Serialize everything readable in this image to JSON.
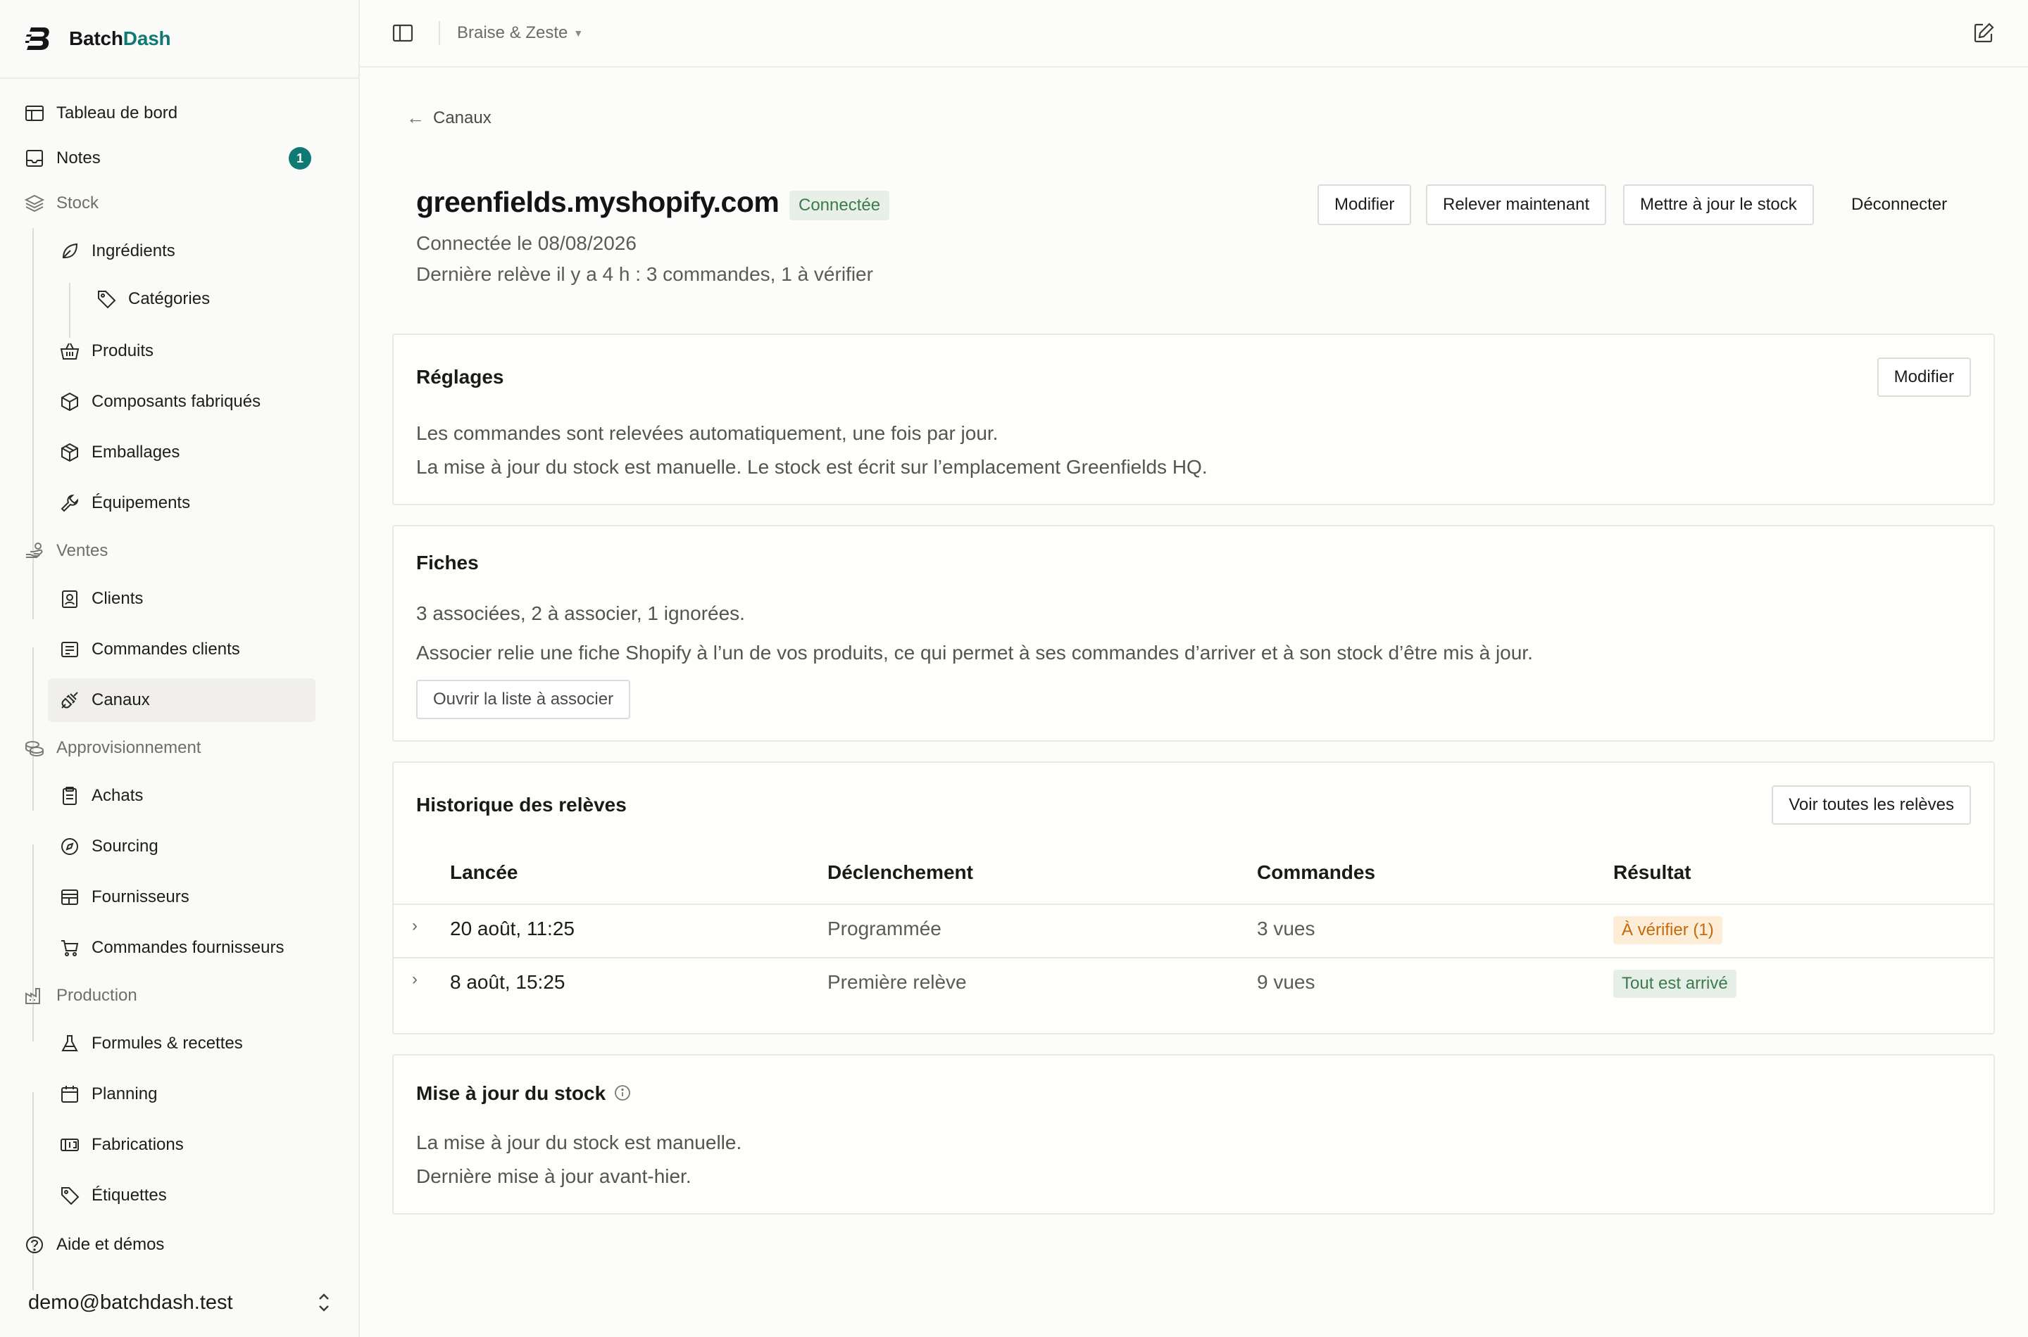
{
  "brand": {
    "name_part1": "Batch",
    "name_part2": "Dash",
    "accent": "#0f7a73"
  },
  "sidebar": {
    "dashboard": "Tableau de bord",
    "notes": "Notes",
    "notes_badge": "1",
    "stock": "Stock",
    "ingredients": "Ingrédients",
    "categories": "Catégories",
    "products": "Produits",
    "components": "Composants fabriqués",
    "packaging": "Emballages",
    "equipment": "Équipements",
    "sales": "Ventes",
    "clients": "Clients",
    "client_orders": "Commandes clients",
    "channels": "Canaux",
    "supply": "Approvisionnement",
    "purchases": "Achats",
    "sourcing": "Sourcing",
    "suppliers": "Fournisseurs",
    "supplier_orders": "Commandes fournisseurs",
    "production": "Production",
    "formulas": "Formules & recettes",
    "planning": "Planning",
    "fabrications": "Fabrications",
    "labels": "Étiquettes",
    "help": "Aide et démos",
    "user_email": "demo@batchdash.test"
  },
  "topbar": {
    "workspace": "Braise & Zeste"
  },
  "page": {
    "back_label": "Canaux",
    "store": "greenfields.myshopify.com",
    "status": "Connectée",
    "connected_on": "Connectée le 08/08/2026",
    "last_fetch": "Dernière relève il y a 4 h : 3 commandes, 1 à vérifier",
    "actions": {
      "edit": "Modifier",
      "fetch_now": "Relever maintenant",
      "update_stock": "Mettre à jour le stock",
      "disconnect": "Déconnecter"
    }
  },
  "settings": {
    "title": "Réglages",
    "edit": "Modifier",
    "line1": "Les commandes sont relevées automatiquement, une fois par jour.",
    "line2": "La mise à jour du stock est manuelle. Le stock est écrit sur l’emplacement Greenfields HQ."
  },
  "listings": {
    "title": "Fiches",
    "summary": "3 associées, 2 à associer, 1 ignorées.",
    "help": "Associer relie une fiche Shopify à l’un de vos produits, ce qui permet à ses commandes d’arriver et à son stock d’être mis à jour.",
    "open_button": "Ouvrir la liste à associer"
  },
  "history": {
    "title": "Historique des relèves",
    "see_all": "Voir toutes les relèves",
    "columns": [
      "Lancée",
      "Déclenchement",
      "Commandes",
      "Résultat"
    ],
    "rows": [
      {
        "launched": "20 août, 11:25",
        "trigger": "Programmée",
        "orders": "3 vues",
        "result": "À vérifier (1)",
        "result_type": "warn"
      },
      {
        "launched": "8 août, 15:25",
        "trigger": "Première relève",
        "orders": "9 vues",
        "result": "Tout est arrivé",
        "result_type": "ok"
      }
    ]
  },
  "stock_update": {
    "title": "Mise à jour du stock",
    "line1": "La mise à jour du stock est manuelle.",
    "line2": "Dernière mise à jour avant-hier."
  }
}
